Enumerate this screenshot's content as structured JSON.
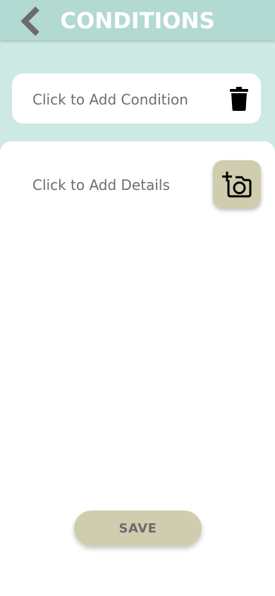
{
  "header": {
    "title": "CONDITIONS",
    "back_icon": "chevron-left-icon"
  },
  "condition": {
    "placeholder": "Click to Add Condition",
    "delete_icon": "trash-icon"
  },
  "details": {
    "placeholder": "Click to Add Details",
    "add_photo_icon": "add-camera-icon"
  },
  "footer": {
    "save_label": "SAVE"
  },
  "colors": {
    "background": "#cde9e4",
    "header": "#b2d9d2",
    "accent_button": "#cfcdae",
    "placeholder_text": "#6e6e6e",
    "back_icon": "#6b6b6b"
  }
}
